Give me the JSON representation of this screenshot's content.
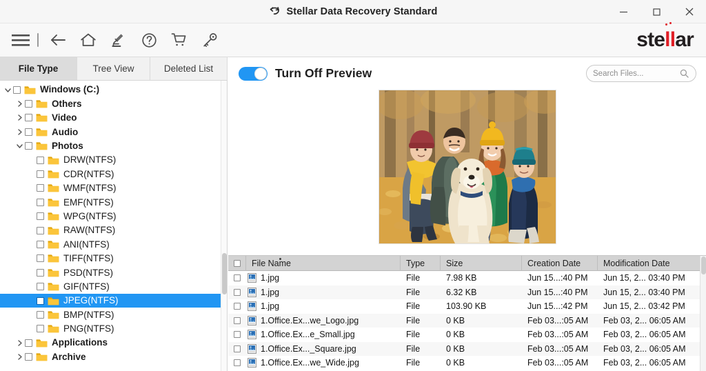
{
  "window": {
    "title": "Stellar Data Recovery Standard",
    "restore_icon": "restore-arrow-icon",
    "minimize_label": "–",
    "maximize_label": "□",
    "close_label": "✕"
  },
  "toolbar": {
    "icons": [
      {
        "name": "hamburger-menu-icon",
        "label": "Menu"
      },
      {
        "name": "back-arrow-icon",
        "label": "Back"
      },
      {
        "name": "home-icon",
        "label": "Home"
      },
      {
        "name": "microscope-icon",
        "label": "Scan Settings"
      },
      {
        "name": "help-circle-icon",
        "label": "Help"
      },
      {
        "name": "shopping-cart-icon",
        "label": "Buy"
      },
      {
        "name": "key-icon",
        "label": "Activation"
      }
    ],
    "logo_part1": "ste",
    "logo_part2": "ll",
    "logo_part3": "ar",
    "logo_accent_color": "#e01f26"
  },
  "left_panel": {
    "tabs": [
      {
        "label": "File Type",
        "active": true
      },
      {
        "label": "Tree View",
        "active": false
      },
      {
        "label": "Deleted List",
        "active": false
      }
    ],
    "tree": [
      {
        "label": "Windows (C:)",
        "level": 0,
        "caret": "down",
        "bold": true,
        "selected": false
      },
      {
        "label": "Others",
        "level": 1,
        "caret": "right",
        "bold": true,
        "selected": false
      },
      {
        "label": "Video",
        "level": 1,
        "caret": "right",
        "bold": true,
        "selected": false
      },
      {
        "label": "Audio",
        "level": 1,
        "caret": "right",
        "bold": true,
        "selected": false
      },
      {
        "label": "Photos",
        "level": 1,
        "caret": "down",
        "bold": true,
        "selected": false
      },
      {
        "label": "DRW(NTFS)",
        "level": 2,
        "caret": "none",
        "bold": false,
        "selected": false
      },
      {
        "label": "CDR(NTFS)",
        "level": 2,
        "caret": "none",
        "bold": false,
        "selected": false
      },
      {
        "label": "WMF(NTFS)",
        "level": 2,
        "caret": "none",
        "bold": false,
        "selected": false
      },
      {
        "label": "EMF(NTFS)",
        "level": 2,
        "caret": "none",
        "bold": false,
        "selected": false
      },
      {
        "label": "WPG(NTFS)",
        "level": 2,
        "caret": "none",
        "bold": false,
        "selected": false
      },
      {
        "label": "RAW(NTFS)",
        "level": 2,
        "caret": "none",
        "bold": false,
        "selected": false
      },
      {
        "label": "ANI(NTFS)",
        "level": 2,
        "caret": "none",
        "bold": false,
        "selected": false
      },
      {
        "label": "TIFF(NTFS)",
        "level": 2,
        "caret": "none",
        "bold": false,
        "selected": false
      },
      {
        "label": "PSD(NTFS)",
        "level": 2,
        "caret": "none",
        "bold": false,
        "selected": false
      },
      {
        "label": "GIF(NTFS)",
        "level": 2,
        "caret": "none",
        "bold": false,
        "selected": false
      },
      {
        "label": "JPEG(NTFS)",
        "level": 2,
        "caret": "none",
        "bold": false,
        "selected": true
      },
      {
        "label": "BMP(NTFS)",
        "level": 2,
        "caret": "none",
        "bold": false,
        "selected": false
      },
      {
        "label": "PNG(NTFS)",
        "level": 2,
        "caret": "none",
        "bold": false,
        "selected": false
      },
      {
        "label": "Applications",
        "level": 1,
        "caret": "right",
        "bold": true,
        "selected": false
      },
      {
        "label": "Archive",
        "level": 1,
        "caret": "right",
        "bold": true,
        "selected": false
      }
    ],
    "selection_color": "#2196f3"
  },
  "preview": {
    "toggle_label": "Turn Off Preview",
    "toggle_on": true,
    "toggle_color": "#2196f3",
    "image_alt": "family-with-dog-autumn-forest-photo"
  },
  "search": {
    "placeholder": "Search Files...",
    "value": "",
    "icon": "search-icon"
  },
  "file_table": {
    "columns": [
      "File Name",
      "Type",
      "Size",
      "Creation Date",
      "Modification Date"
    ],
    "rows": [
      {
        "name": "1.jpg",
        "type": "File",
        "size": "7.98 KB",
        "created": "Jun 15...:40 PM",
        "modified": "Jun 15, 2... 03:40 PM"
      },
      {
        "name": "1.jpg",
        "type": "File",
        "size": "6.32 KB",
        "created": "Jun 15...:40 PM",
        "modified": "Jun 15, 2... 03:40 PM"
      },
      {
        "name": "1.jpg",
        "type": "File",
        "size": "103.90 KB",
        "created": "Jun 15...:42 PM",
        "modified": "Jun 15, 2... 03:42 PM"
      },
      {
        "name": "1.Office.Ex...we_Logo.jpg",
        "type": "File",
        "size": "0 KB",
        "created": "Feb 03...:05 AM",
        "modified": "Feb 03, 2... 06:05 AM"
      },
      {
        "name": "1.Office.Ex...e_Small.jpg",
        "type": "File",
        "size": "0 KB",
        "created": "Feb 03...:05 AM",
        "modified": "Feb 03, 2... 06:05 AM"
      },
      {
        "name": "1.Office.Ex..._Square.jpg",
        "type": "File",
        "size": "0 KB",
        "created": "Feb 03...:05 AM",
        "modified": "Feb 03, 2... 06:05 AM"
      },
      {
        "name": "1.Office.Ex...we_Wide.jpg",
        "type": "File",
        "size": "0 KB",
        "created": "Feb 03...:05 AM",
        "modified": "Feb 03, 2... 06:05 AM"
      }
    ]
  }
}
